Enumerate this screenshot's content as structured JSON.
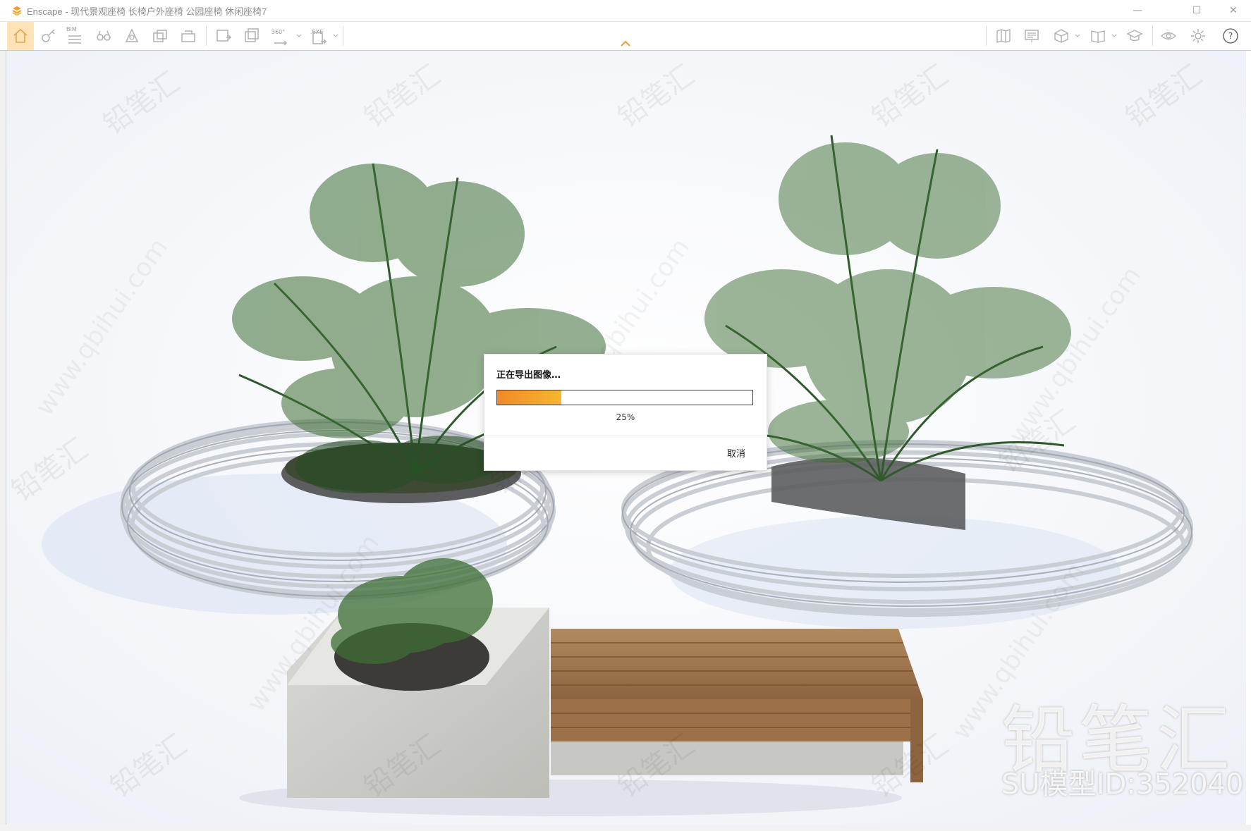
{
  "window": {
    "title": "Enscape - 现代景观座椅 长椅户外座椅 公园座椅 休闲座椅7",
    "buttons": {
      "minimize": "—",
      "maximize": "☐",
      "close": "✕"
    }
  },
  "toolbar": {
    "left_icons": [
      "home-icon",
      "tag-icon",
      "bim-icon",
      "binoculars-icon",
      "asset-library-icon",
      "views-icon",
      "layers-icon",
      "screenshot-icon",
      "batch-render-icon",
      "panorama-icon",
      "exe-export-icon"
    ],
    "bim_label": "BIM",
    "panorama_label": "360°",
    "exe_label": ".EXE",
    "right_icons": [
      "map-icon",
      "presentation-icon",
      "cube-icon",
      "book-icon",
      "graduation-cap-icon",
      "eye-icon",
      "settings-icon",
      "help-icon"
    ],
    "help_label": "?"
  },
  "watermark": {
    "brand": "铅笔汇",
    "model_id": "SU模型ID:352040",
    "url": "www.qbihui.com",
    "repeat_brand": "铅笔汇"
  },
  "dialog": {
    "title": "正在导出图像…",
    "progress": 25,
    "progress_text": "25%",
    "cancel_label": "取消",
    "fill_colors": [
      "#f08a2a",
      "#f8b62f"
    ]
  },
  "colors": {
    "home_highlight": "#fde3b6",
    "accent": "#f29e2b",
    "background": "#f4f6fb"
  }
}
